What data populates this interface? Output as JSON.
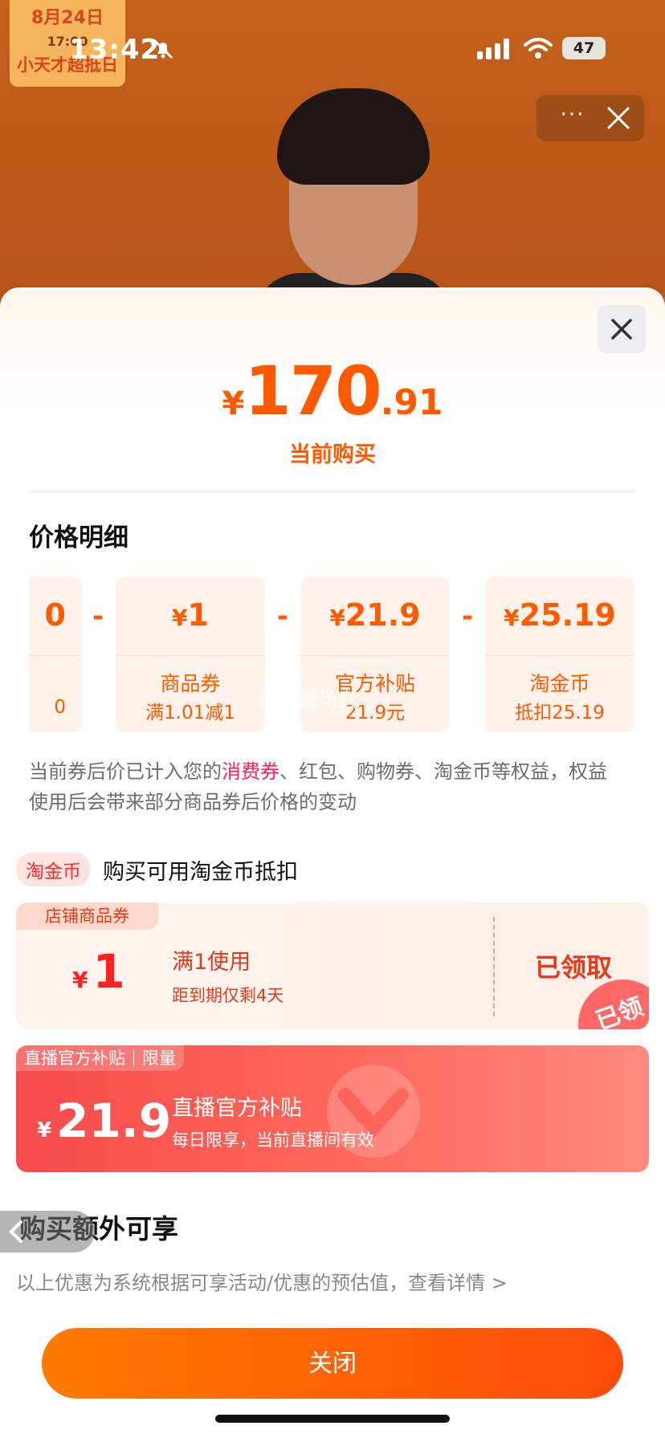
{
  "status_bar": {
    "time": "13:42",
    "battery": "47"
  },
  "promo": {
    "date": "8月24日",
    "time": "17:00",
    "slogan": "小天才超抵日"
  },
  "stream_controls": {
    "more": "···"
  },
  "price": {
    "currency": "¥",
    "integer": "170",
    "decimal": ".91",
    "label": "当前购买"
  },
  "detail_title": "价格明细",
  "breakdown": [
    {
      "amount": "0",
      "name": "",
      "desc": "0"
    },
    {
      "operator": "-",
      "amount": "1",
      "name": "商品券",
      "desc": "满1.01减1"
    },
    {
      "operator": "-",
      "amount": "21.9",
      "name": "官方补贴",
      "desc": "21.9元"
    },
    {
      "operator": "-",
      "amount": "25.19",
      "name": "淘金币",
      "desc": "抵扣25.19"
    }
  ],
  "watermark": "陪我看场直",
  "note": {
    "prefix": "当前券后价已计入您的",
    "highlight": "消费券",
    "suffix": "、红包、购物券、淘金币等权益，权益使用后会带来部分商品券后价格的变动"
  },
  "coin": {
    "tag": "淘金币",
    "text": "购买可用淘金币抵扣"
  },
  "shop_coupon": {
    "tag": "店铺商品券",
    "currency": "¥",
    "amount": "1",
    "condition": "满1使用",
    "expire": "距到期仅剩4天",
    "status": "已领取",
    "stamp": "已领"
  },
  "live_coupon": {
    "tag": "直播官方补贴｜限量",
    "currency": "¥",
    "amount": "21.9",
    "title": "直播官方补贴",
    "subtitle": "每日限享，当前直播间有效"
  },
  "extra_title": "购买额外可享",
  "disclaimer": "以上优惠为系统根据可享活动/优惠的预估值，查看详情 >",
  "close_label": "关闭"
}
